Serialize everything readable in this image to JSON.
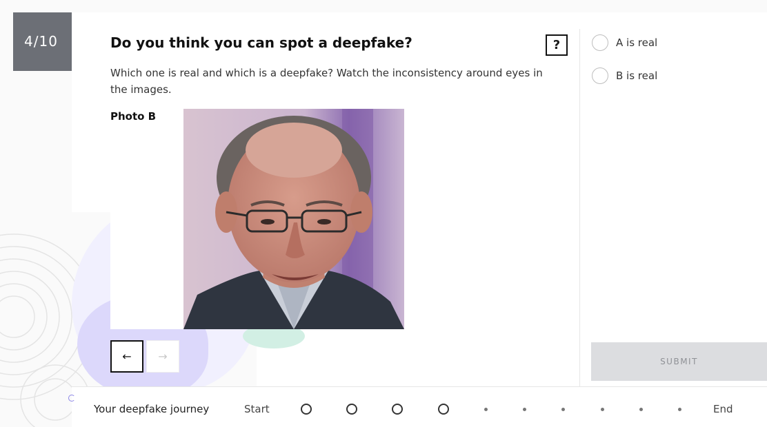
{
  "progress": {
    "label": "4/10",
    "current": 4,
    "total": 10
  },
  "question": {
    "title": "Do you think you can spot a deepfake?",
    "help_label": "?",
    "description": "Which one is real and which is a deepfake? Watch the inconsistency around eyes in the images.",
    "photo_label": "Photo B"
  },
  "navigation": {
    "prev_icon": "arrow-left-icon",
    "next_icon": "arrow-right-icon",
    "prev_glyph": "←",
    "next_glyph": "→"
  },
  "options": [
    {
      "label": "A is real",
      "selected": false
    },
    {
      "label": "B is real",
      "selected": false
    }
  ],
  "submit": {
    "label": "SUBMIT",
    "enabled": false
  },
  "journey": {
    "title": "Your deepfake journey",
    "start_label": "Start",
    "end_label": "End",
    "completed_steps": 4,
    "remaining_steps": 6
  },
  "colors": {
    "counter_bg": "#6c6f76",
    "submit_bg": "#dcdde0",
    "accent_lilac": "#dcd8fb",
    "accent_mint": "#d2efe4"
  }
}
